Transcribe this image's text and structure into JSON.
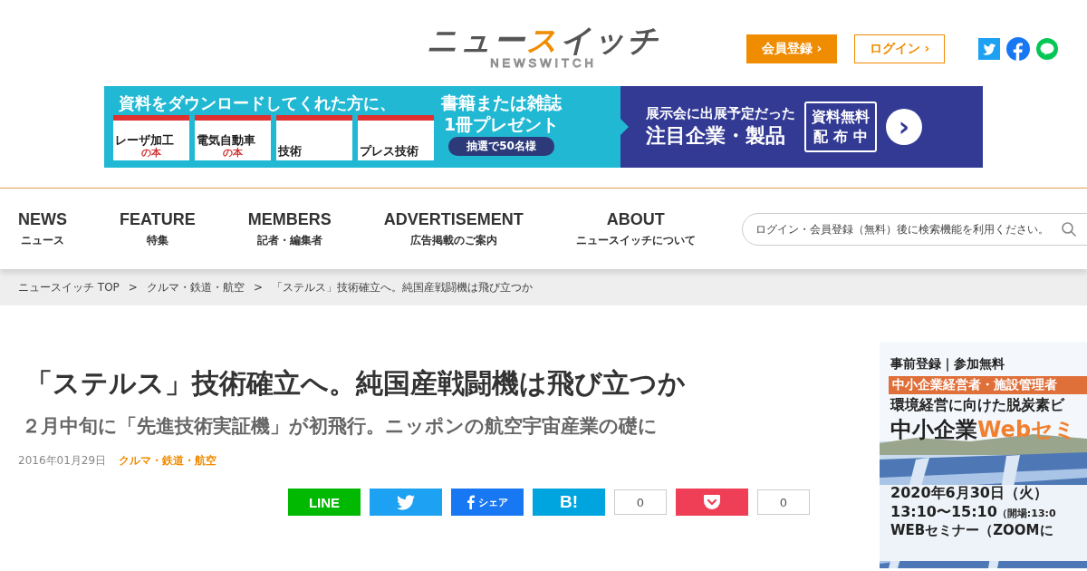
{
  "header": {
    "logo": [
      {
        "text": "ニュー",
        "accent": false
      },
      {
        "text": "ス",
        "accent": true
      },
      {
        "text": "イッチ",
        "accent": false
      }
    ],
    "logo_sub": "NEWSWITCH",
    "register_button": "会員登録",
    "login_button": "ログイン",
    "chevron": "›"
  },
  "banner": {
    "headline": "資料をダウンロードしてくれた方に、",
    "offer_lines": [
      "書籍または雑誌",
      "1冊プレゼント"
    ],
    "lottery": "抽選で50名様",
    "books": [
      {
        "label": "レーザ加工",
        "sub": "の本"
      },
      {
        "label": "電気自動車",
        "sub": "の本"
      },
      {
        "label": "技術"
      },
      {
        "label": "プレス技術"
      }
    ],
    "right_line1": "展示会に出展予定だった",
    "right_line2": "注目企業・製品",
    "badge_lines": [
      "資料無料",
      "配 布 中"
    ],
    "arrow": "›"
  },
  "nav": {
    "items": [
      {
        "title": "NEWS",
        "sub": "ニュース"
      },
      {
        "title": "FEATURE",
        "sub": "特集"
      },
      {
        "title": "MEMBERS",
        "sub": "記者・編集者"
      },
      {
        "title": "ADVERTISEMENT",
        "sub": "広告掲載のご案内"
      },
      {
        "title": "ABOUT",
        "sub": "ニュースイッチについて"
      }
    ],
    "search": {
      "placeholder": "ログイン・会員登録（無料）後に検索機能を利用ください。"
    }
  },
  "breadcrumb": {
    "items": [
      "ニュースイッチ TOP",
      "クルマ・鉄道・航空",
      "「ステルス」技術確立へ。純国産戦闘機は飛び立つか"
    ],
    "separator": ">"
  },
  "article": {
    "title": "「ステルス」技術確立へ。純国産戦闘機は飛び立つか",
    "subtitle": "２月中旬に「先進技術実証機」が初飛行。ニッポンの航空宇宙産業の礎に",
    "date": "2016年01月29日",
    "category": "クルマ・鉄道・航空",
    "share": [
      {
        "kind": "line",
        "label": "LINE"
      },
      {
        "kind": "twitter"
      },
      {
        "kind": "facebook",
        "label": "シェア"
      },
      {
        "kind": "hatena",
        "label": "B!",
        "count": "0"
      },
      {
        "kind": "pocket",
        "count": "0"
      }
    ]
  },
  "side_ad": {
    "top": "事前登録｜参加無料",
    "target": "中小企業経営者・施設管理者",
    "lead": "環境経営に向けた脱炭素ビ",
    "title_dark": "中小企業",
    "title_accent": "Webセミ",
    "date": "2020年6月30日（火）",
    "time": "13:10〜15:10",
    "time_note": "（開場:13:0",
    "format": "WEBセミナー（ZOOMに"
  }
}
